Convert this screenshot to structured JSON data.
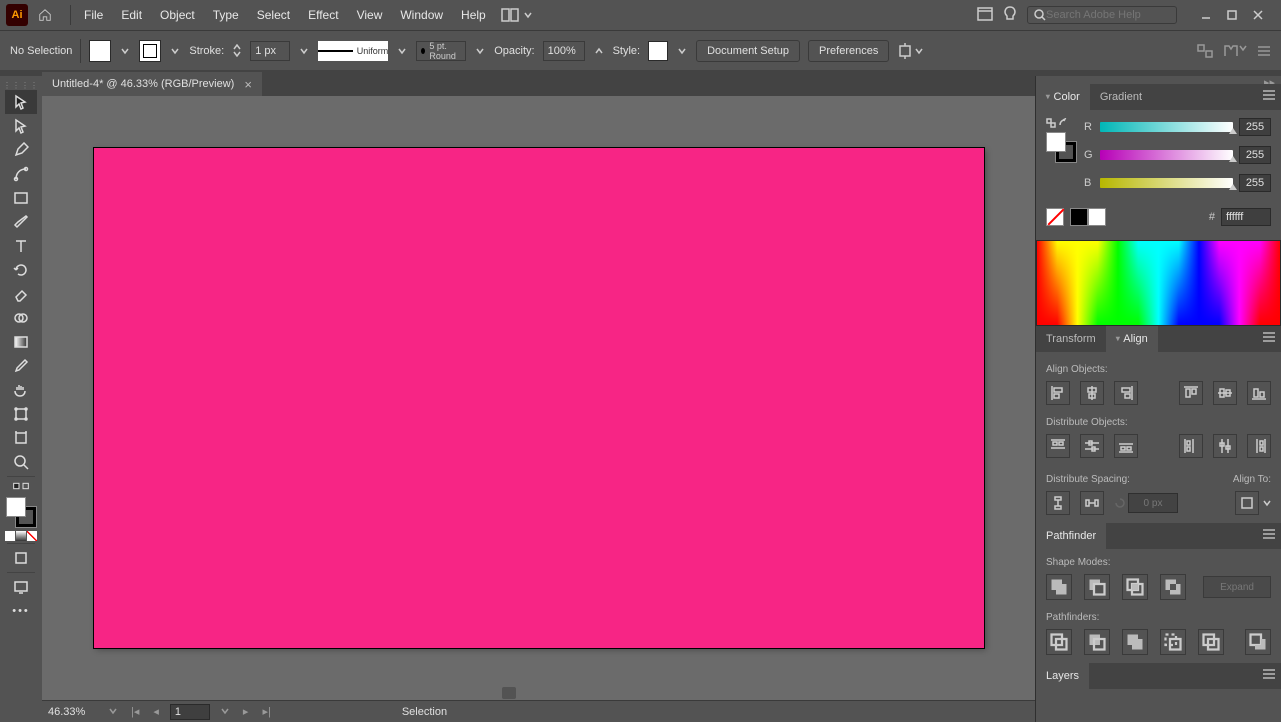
{
  "menubar": {
    "logo": "Ai",
    "items": [
      "File",
      "Edit",
      "Object",
      "Type",
      "Select",
      "Effect",
      "View",
      "Window",
      "Help"
    ],
    "search_placeholder": "Search Adobe Help"
  },
  "controlbar": {
    "selection_label": "No Selection",
    "stroke_label": "Stroke:",
    "stroke_value": "1 px",
    "profile_label": "Uniform",
    "brush_label": "5 pt. Round",
    "opacity_label": "Opacity:",
    "opacity_value": "100%",
    "style_label": "Style:",
    "doc_setup": "Document Setup",
    "preferences": "Preferences"
  },
  "document": {
    "tab_title": "Untitled-4* @ 46.33% (RGB/Preview)",
    "artboard_fill": "#f72585"
  },
  "statusbar": {
    "zoom": "46.33%",
    "page": "1",
    "tool": "Selection"
  },
  "panels": {
    "color": {
      "tab": "Color",
      "gradient_tab": "Gradient",
      "r_label": "R",
      "r_value": "255",
      "g_label": "G",
      "g_value": "255",
      "b_label": "B",
      "b_value": "255",
      "hex_label": "#",
      "hex_value": "ffffff"
    },
    "transform_tab": "Transform",
    "align": {
      "tab": "Align",
      "align_objects": "Align Objects:",
      "distribute_objects": "Distribute Objects:",
      "distribute_spacing": "Distribute Spacing:",
      "align_to": "Align To:",
      "spacing_value": "0 px"
    },
    "pathfinder": {
      "tab": "Pathfinder",
      "shape_modes": "Shape Modes:",
      "pathfinders": "Pathfinders:",
      "expand": "Expand"
    },
    "layers_tab": "Layers"
  }
}
